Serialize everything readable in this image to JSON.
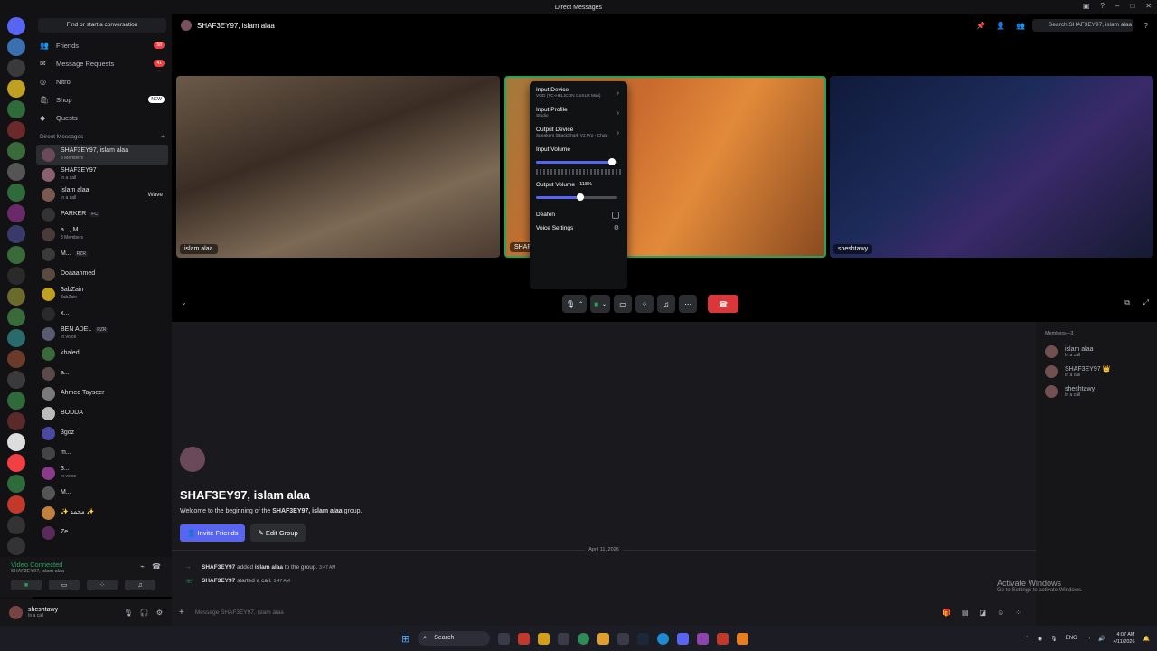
{
  "window": {
    "title": "Direct Messages"
  },
  "guild_badges": [
    "",
    "",
    "",
    "",
    "",
    "",
    "",
    "",
    "",
    "",
    "",
    "",
    "",
    "",
    "",
    "",
    "",
    "",
    "",
    "",
    "",
    "",
    "",
    "",
    "",
    "",
    "NEW"
  ],
  "sidebar": {
    "search_label": "Find or start a conversation",
    "nav": [
      {
        "label": "Friends",
        "badge": "58",
        "icon": "friends-icon"
      },
      {
        "label": "Message Requests",
        "badge": "41",
        "icon": "mail-icon"
      },
      {
        "label": "Nitro",
        "badge": "",
        "icon": "nitro-icon"
      },
      {
        "label": "Shop",
        "badge": "NEW",
        "icon": "shop-icon"
      },
      {
        "label": "Quests",
        "badge": "",
        "icon": "quests-icon"
      }
    ],
    "dm_header": "Direct Messages",
    "add_dm": "+",
    "dms": [
      {
        "name": "SHAF3EY97, islam alaa",
        "sub": "3 Members",
        "tag": "",
        "extra": ""
      },
      {
        "name": "SHAF3EY97",
        "sub": "In a call",
        "tag": "",
        "extra": ""
      },
      {
        "name": "islam alaa",
        "sub": "In a call",
        "tag": "",
        "extra": "Wave"
      },
      {
        "name": "PARKER",
        "sub": "",
        "tag": "FC",
        "extra": ""
      },
      {
        "name": "a..., M...",
        "sub": "3 Members",
        "tag": "",
        "extra": ""
      },
      {
        "name": "M...",
        "sub": "",
        "tag": "RZR",
        "extra": ""
      },
      {
        "name": "Doaaahmed",
        "sub": "",
        "tag": "",
        "extra": ""
      },
      {
        "name": "3abZain",
        "sub": "3abZain",
        "tag": "",
        "extra": ""
      },
      {
        "name": "x...",
        "sub": "",
        "tag": "",
        "extra": ""
      },
      {
        "name": "BEN ADEL",
        "sub": "In voice",
        "tag": "RZR",
        "extra": ""
      },
      {
        "name": "khaled",
        "sub": "",
        "tag": "",
        "extra": ""
      },
      {
        "name": "a...",
        "sub": "",
        "tag": "",
        "extra": ""
      },
      {
        "name": "Ahmed Tayseer",
        "sub": "",
        "tag": "",
        "extra": ""
      },
      {
        "name": "BODDA",
        "sub": "",
        "tag": "",
        "extra": ""
      },
      {
        "name": "3goz",
        "sub": "",
        "tag": "",
        "extra": ""
      },
      {
        "name": "m...",
        "sub": "",
        "tag": "",
        "extra": ""
      },
      {
        "name": "3...",
        "sub": "In voice",
        "tag": "",
        "extra": ""
      },
      {
        "name": "M...",
        "sub": "",
        "tag": "",
        "extra": ""
      },
      {
        "name": "✨ ﻣﺤﻤﺪ ✨",
        "sub": "",
        "tag": "",
        "extra": ""
      },
      {
        "name": "Ze",
        "sub": "",
        "tag": "",
        "extra": ""
      }
    ]
  },
  "voice_panel": {
    "status": "Video Connected",
    "channel": "SHAF3EY97, islam alaa"
  },
  "user": {
    "name": "sheshtawy",
    "status": "In a call"
  },
  "call_header": {
    "title": "SHAF3EY97, islam alaa",
    "search_placeholder": "Search SHAF3EY97, islam alaa"
  },
  "tiles": [
    {
      "label": "islam alaa"
    },
    {
      "label": "SHAF"
    },
    {
      "label": "sheshtawy"
    }
  ],
  "voice_menu": {
    "input_device": {
      "title": "Input Device",
      "value": "VOD (TC-HELICON GoXLR Mini)"
    },
    "input_profile": {
      "title": "Input Profile",
      "value": "Studio"
    },
    "output_device": {
      "title": "Output Device",
      "value": "Speakers (BlackShark V2 Pro - Chat)"
    },
    "input_volume": {
      "title": "Input Volume",
      "level": 0.95
    },
    "output_volume": {
      "title": "Output Volume",
      "tooltip": "118%",
      "level": 0.56
    },
    "deafen": "Deafen",
    "voice_settings": "Voice Settings"
  },
  "chat": {
    "welcome_title": "SHAF3EY97, islam alaa",
    "welcome_pre": "Welcome to the beginning of the ",
    "welcome_bold": "SHAF3EY97, islam alaa",
    "welcome_post": " group.",
    "invite_btn": "Invite Friends",
    "edit_btn": "Edit Group",
    "date": "April 11, 2026",
    "messages": [
      {
        "actor": "SHAF3EY97",
        "text": "added",
        "target": "islam alaa",
        "tail": "to the group.",
        "time": "3:47 AM"
      },
      {
        "actor": "SHAF3EY97",
        "text": "started a call.",
        "target": "",
        "tail": "",
        "time": "3:47 AM"
      }
    ],
    "composer_placeholder": "Message SHAF3EY97, islam alaa"
  },
  "members": {
    "header": "Members—3",
    "list": [
      {
        "name": "islam alaa",
        "sub": "In a call"
      },
      {
        "name": "SHAF3EY97 👑",
        "sub": "In a call"
      },
      {
        "name": "sheshtawy",
        "sub": "In a call"
      }
    ]
  },
  "watermark": {
    "title": "Activate Windows",
    "sub": "Go to Settings to activate Windows."
  },
  "taskbar": {
    "search": "Search",
    "lang": "ENG",
    "time": "4:07 AM",
    "date": "4/11/2026"
  }
}
